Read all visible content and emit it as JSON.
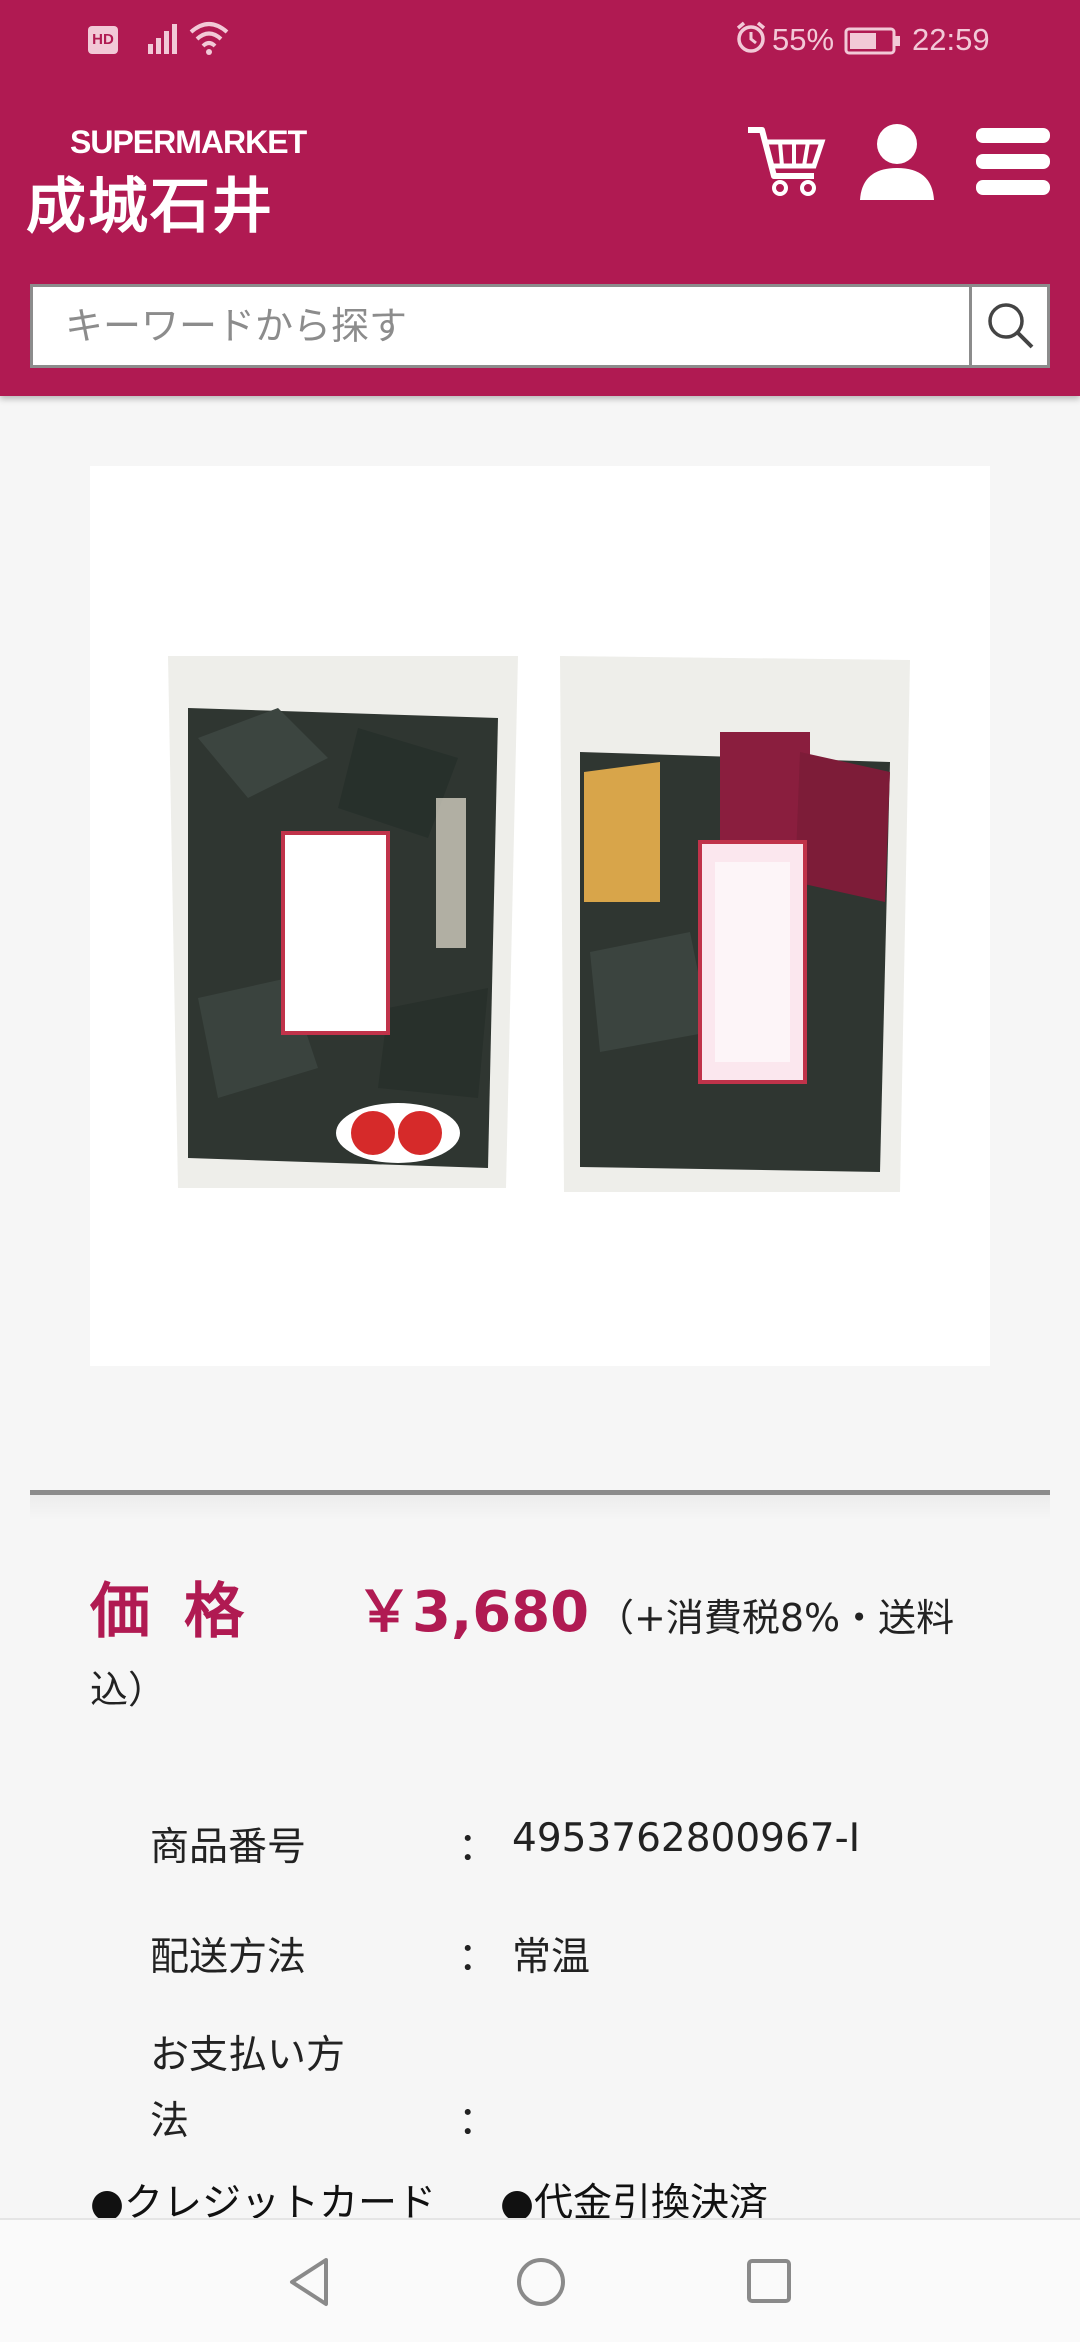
{
  "status_bar": {
    "hd": "HD",
    "battery_pct": "55%",
    "time": "22:59"
  },
  "header": {
    "logo_top": "SUPERMARKET",
    "logo_main": "成城石井"
  },
  "search": {
    "placeholder": "キーワードから探す"
  },
  "price": {
    "label": "価格",
    "value": "￥3,680",
    "note_line1": "（+消費税8%・送料",
    "note_line2": "込）"
  },
  "specs": {
    "product_number": {
      "label": "商品番号",
      "colon": "：",
      "value": "4953762800967-I"
    },
    "delivery": {
      "label": "配送方法",
      "colon": "：",
      "value": "常温"
    },
    "payment": {
      "label_line1": "お支払い方",
      "label_line2": "法",
      "colon": "："
    }
  },
  "payments": [
    "●クレジットカード",
    "●代金引換決済"
  ],
  "colors": {
    "brand": "#b01a52",
    "background": "#f6f6f6"
  },
  "icons": [
    "cart-icon",
    "user-icon",
    "menu-icon",
    "search-icon",
    "back-icon",
    "home-icon",
    "recent-apps-icon"
  ]
}
